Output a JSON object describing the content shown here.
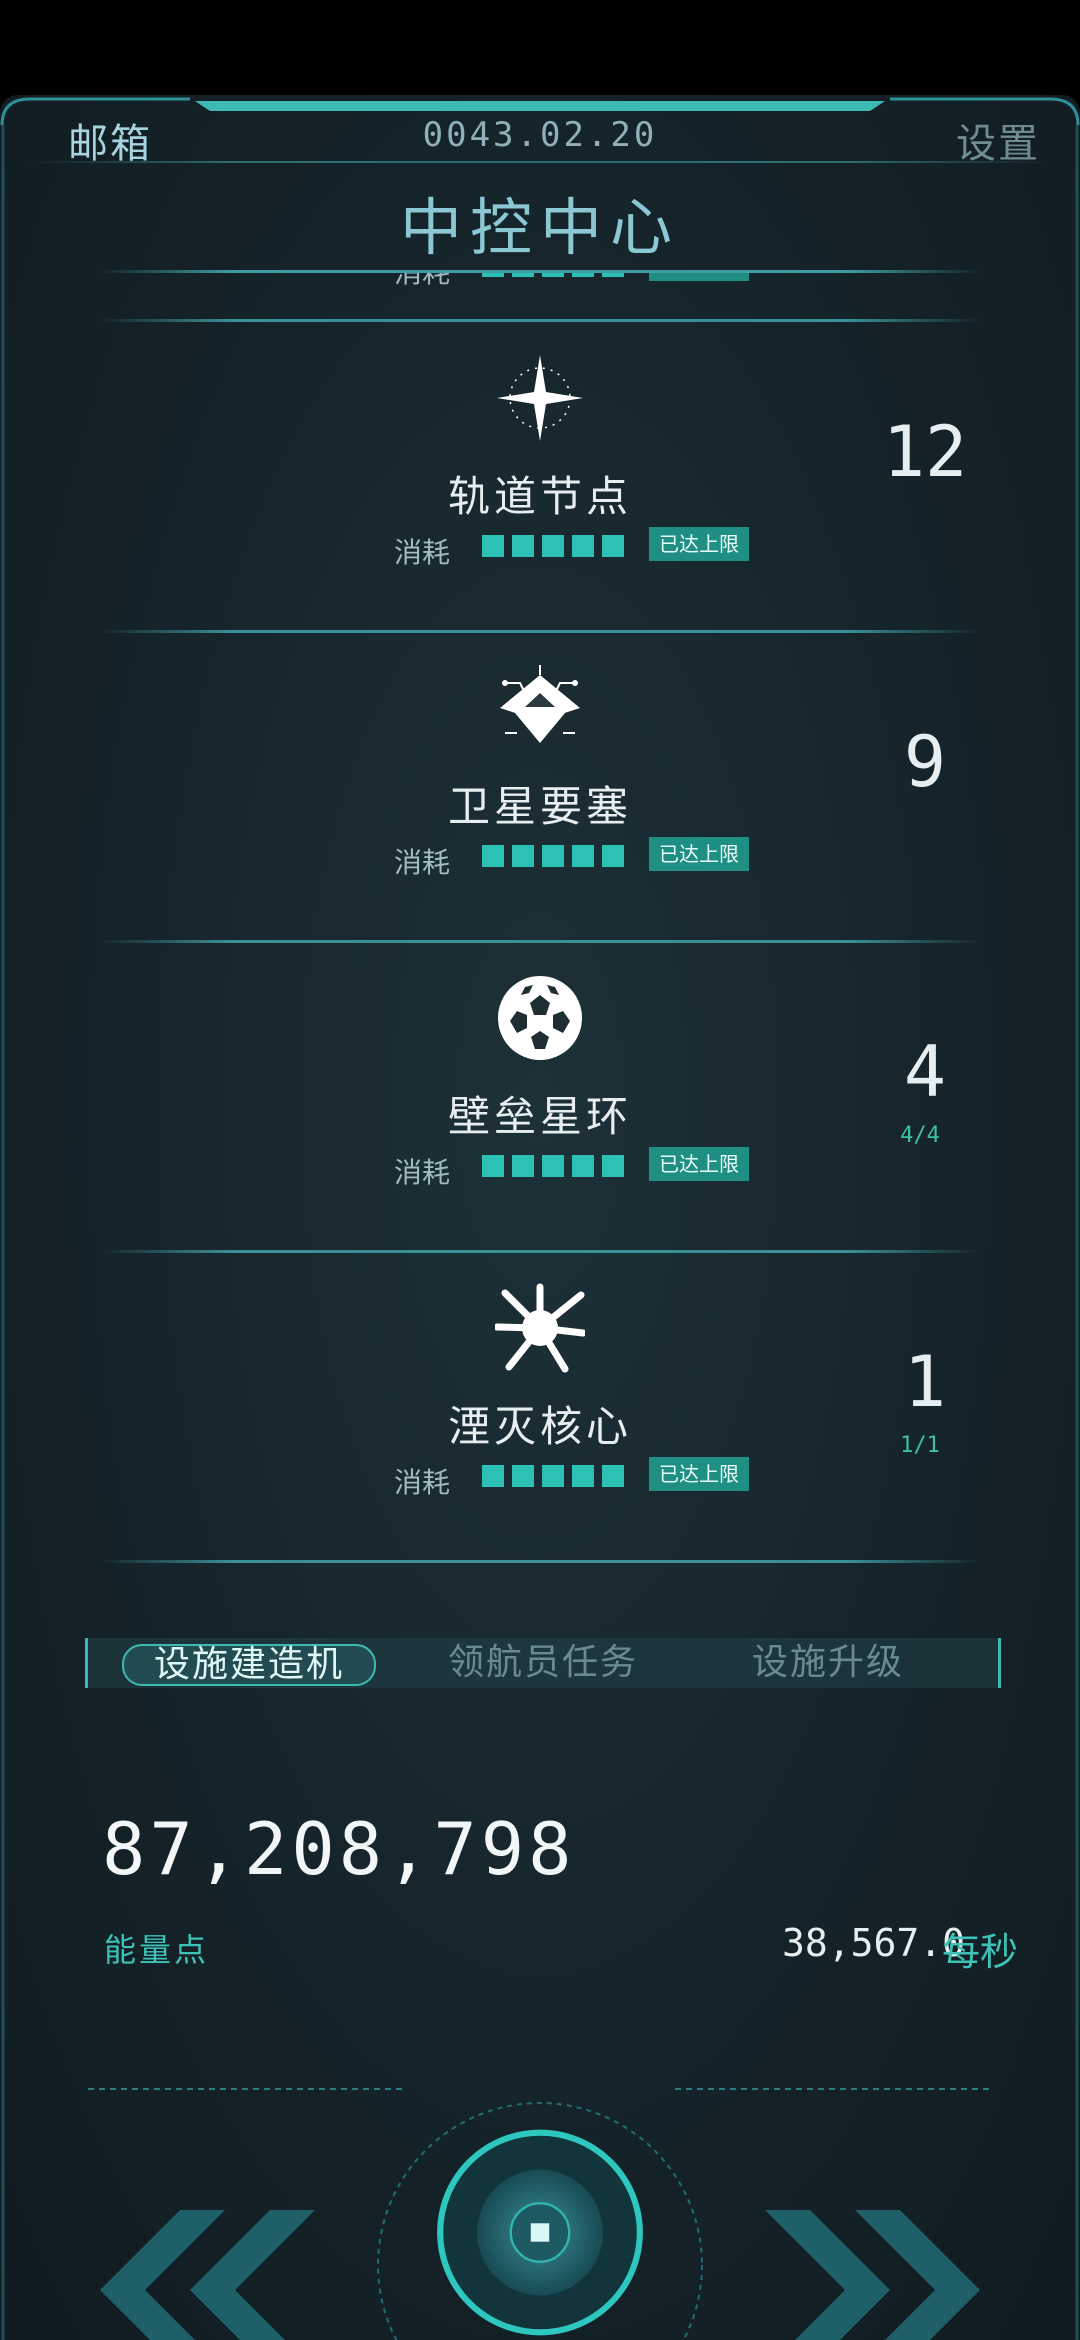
{
  "header": {
    "mailbox": "邮箱",
    "date": "0043.02.20",
    "settings": "设置",
    "title": "中控中心"
  },
  "items": [
    {
      "name": "轨道节点",
      "count": "12",
      "limit": "",
      "cost_label": "消耗",
      "status": "已达上限",
      "icon": "orbital-node-star-icon"
    },
    {
      "name": "卫星要塞",
      "count": "9",
      "limit": "",
      "cost_label": "消耗",
      "status": "已达上限",
      "icon": "satellite-fortress-icon"
    },
    {
      "name": "壁垒星环",
      "count": "4",
      "limit": "4/4",
      "cost_label": "消耗",
      "status": "已达上限",
      "icon": "bastion-ring-sphere-icon"
    },
    {
      "name": "湮灭核心",
      "count": "1",
      "limit": "1/1",
      "cost_label": "消耗",
      "status": "已达上限",
      "icon": "annihilation-core-burst-icon"
    }
  ],
  "partial_item": {
    "cost_label": "消耗",
    "status": "已达上限"
  },
  "tabs": [
    {
      "label": "设施建造机",
      "active": true
    },
    {
      "label": "领航员任务",
      "active": false
    },
    {
      "label": "设施升级",
      "active": false
    }
  ],
  "resources": {
    "energy_value": "87,208,798",
    "energy_label": "能量点",
    "rate_value": "38,567.0",
    "rate_unit": "每秒"
  },
  "colors": {
    "accent": "#2cc1b4",
    "background": "#15242a",
    "badge": "#1f8f84"
  }
}
